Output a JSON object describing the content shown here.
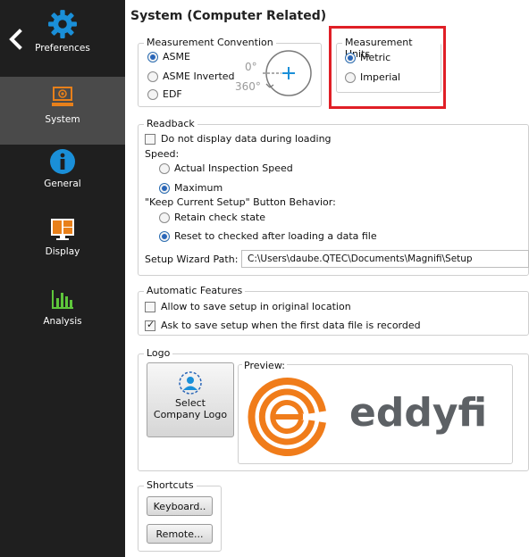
{
  "sidebar": {
    "items": [
      {
        "label": "Preferences",
        "icon": "gear-icon",
        "active": false
      },
      {
        "label": "System",
        "icon": "computer-icon",
        "active": true
      },
      {
        "label": "General",
        "icon": "info-icon",
        "active": false
      },
      {
        "label": "Display",
        "icon": "monitor-icon",
        "active": false
      },
      {
        "label": "Analysis",
        "icon": "bar-chart-icon",
        "active": false
      }
    ]
  },
  "page": {
    "title": "System (Computer Related)"
  },
  "measurement_convention": {
    "legend": "Measurement Convention",
    "options": [
      "ASME",
      "ASME Inverted",
      "EDF"
    ],
    "selected": "ASME",
    "diagram_top": "0°",
    "diagram_bottom": "360°"
  },
  "measurement_units": {
    "legend": "Measurement Units",
    "options": [
      "Metric",
      "Imperial"
    ],
    "selected": "Metric"
  },
  "readback": {
    "legend": "Readback",
    "no_display_label": "Do not display data during loading",
    "no_display_checked": false,
    "speed_label": "Speed:",
    "speed_options": [
      "Actual Inspection Speed",
      "Maximum"
    ],
    "speed_selected": "Maximum",
    "keep_setup_label": "\"Keep Current Setup\" Button Behavior:",
    "keep_setup_options": [
      "Retain check state",
      "Reset to checked after loading a data file"
    ],
    "keep_setup_selected": "Reset to checked after loading a data file",
    "wizard_path_label": "Setup Wizard Path:",
    "wizard_path_value": "C:\\Users\\daube.QTEC\\Documents\\Magnifi\\Setup"
  },
  "automatic_features": {
    "legend": "Automatic Features",
    "allow_save_label": "Allow to save setup in original location",
    "allow_save_checked": false,
    "ask_save_label": "Ask to save setup when the first data file is recorded",
    "ask_save_checked": true
  },
  "logo": {
    "legend": "Logo",
    "select_button_line1": "Select",
    "select_button_line2": "Company Logo",
    "preview_label": "Preview:",
    "brand_text": "eddyfi",
    "brand_color": "#f07c1a"
  },
  "shortcuts": {
    "legend": "Shortcuts",
    "keyboard_button": "Keyboard..",
    "remote_button": "Remote..."
  },
  "colors": {
    "sidebar_bg": "#1f1f1f",
    "active_item_bg": "#4a4a4a",
    "accent_blue": "#1a8fd8",
    "highlight_red": "#e01f26",
    "system_icon_orange": "#e8801a"
  }
}
